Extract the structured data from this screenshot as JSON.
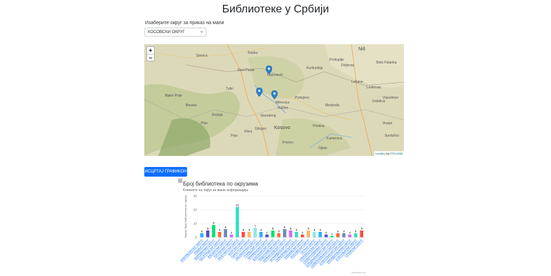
{
  "page": {
    "title": "Библиотеке у Србији"
  },
  "district_select": {
    "label": "Изаберите округ за приказ на мапи",
    "selected": "КОСОВСКИ ОКРУГ"
  },
  "map": {
    "zoom_in": "+",
    "zoom_out": "−",
    "attribution_lib": "Leaflet",
    "attribution_sep": " | By ",
    "attribution_src": "PTN HSM",
    "markers_count": 3,
    "labels": [
      "Niš",
      "Sjenica",
      "Raška",
      "Novi Pazar",
      "Leposavić",
      "Prokuplje",
      "Doljevac",
      "Kuršumlija",
      "Lebane",
      "Leskovac",
      "Vlasotince",
      "Grdelica",
      "Mitrovica",
      "Vučitrn",
      "Podujevo",
      "Kosovo",
      "Pristina",
      "Skenderaj",
      "Medveđa",
      "Vranje",
      "Surdulica",
      "Kamenica",
      "Gjilan",
      "Gllogoc",
      "Klina",
      "Peja",
      "Prizren",
      "Bijelo Polje",
      "Berane",
      "Plav",
      "Rožaje",
      "Tutin",
      "Bela Palanka"
    ]
  },
  "draw_button": {
    "label": "ИСЦРТАЈ ГРАФИКОН"
  },
  "chart_data": {
    "type": "bar",
    "title": "Број библиотека по окрузима",
    "subtitle": "Кликните на округ за више информација",
    "ylabel": "Укупан број библиотека по округу",
    "ylim": [
      0,
      30
    ],
    "yticks": [
      0,
      10,
      20,
      30
    ],
    "categories": [
      "ЗЛАТИБОРСКИ ОКРУГ",
      "РАШКИ ОКРУГ",
      "МОРАВИЧКИ ОКРУГ",
      "БЕОГРАДСКИ ОКРУГ",
      "РАСИНСКИ ОКРУГ",
      "ТОПЛИЧКИ ОКРУГ",
      "ЗАЈЕЧАРСКИ ОКРУГ",
      "БОРСКИ ОКРУГ",
      "ПИРОТСКИ ОКРУГ",
      "ЈАБЛАНИЧКИ ОКРУГ",
      "ПЧИЊСКИ ОКРУГ",
      "МАЧВАНСКИ ОКРУГ",
      "КОЛУБАРСКИ ОКРУГ",
      "ПОДУНАВСКИ ОКРУГ",
      "БРАНИЧЕВСКИ ОКРУГ",
      "ШУМАДИЈСКИ ОКРУГ",
      "ПОМОРАВСКИ ОКРУГ",
      "НИШАВСКИ ОКРУГ",
      "КОСОВСКИ ОКРУГ",
      "ПЕЋКИ ОКРУГ",
      "ПРИЗРЕНСКИ ОКРУГ",
      "СЕВЕРНОБАЧКИ ОКРУГ",
      "СРЕДЊЕБАНАТСКИ ОКРУГ",
      "СЕВЕРНОБАНАТСКИ ОКРУГ",
      "ЈУЖНОБАНАТСКИ ОКРУГ",
      "ЗАПАДНОБАЧКИ ОКРУГ",
      "ЈУЖНОБАЧКИ ОКРУГ",
      "СРЕМСКИ ОКРУГ"
    ],
    "values": [
      3,
      5,
      9,
      4,
      6,
      2,
      22,
      4,
      4,
      7,
      4,
      2,
      5,
      3,
      6,
      5,
      4,
      2,
      5,
      4,
      4,
      2,
      1,
      3,
      3,
      2,
      3,
      5
    ],
    "colors": [
      "#2caffe",
      "#544fc5",
      "#00e272",
      "#fe6a35",
      "#6b8abc",
      "#d568fb",
      "#2ee0ca",
      "#fa4b42",
      "#feb56a",
      "#91e8e1",
      "#2caffe",
      "#544fc5",
      "#00e272",
      "#fe6a35",
      "#6b8abc",
      "#d568fb",
      "#2ee0ca",
      "#fa4b42",
      "#feb56a",
      "#91e8e1",
      "#2caffe",
      "#544fc5",
      "#00e272",
      "#fe6a35",
      "#6b8abc",
      "#d568fb",
      "#2ee0ca",
      "#fa4b42"
    ],
    "credits": "Highcharts.com"
  }
}
